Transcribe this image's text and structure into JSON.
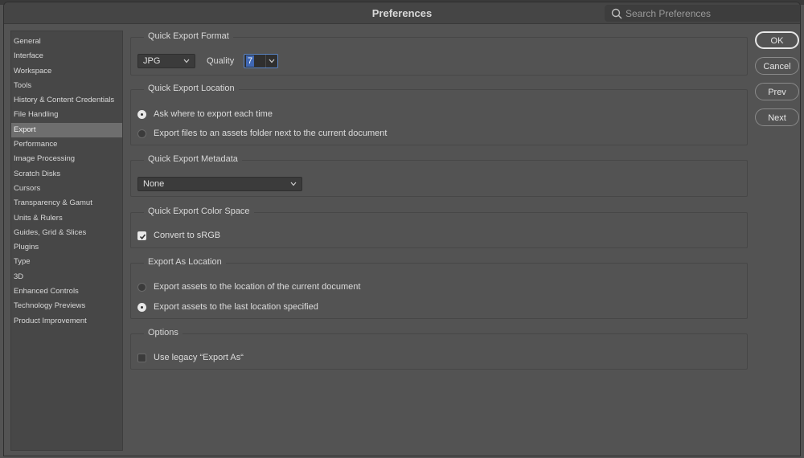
{
  "window": {
    "title": "Preferences"
  },
  "search": {
    "placeholder": "Search Preferences"
  },
  "sidebar": {
    "items": [
      {
        "label": "General"
      },
      {
        "label": "Interface"
      },
      {
        "label": "Workspace"
      },
      {
        "label": "Tools"
      },
      {
        "label": "History & Content Credentials"
      },
      {
        "label": "File Handling"
      },
      {
        "label": "Export"
      },
      {
        "label": "Performance"
      },
      {
        "label": "Image Processing"
      },
      {
        "label": "Scratch Disks"
      },
      {
        "label": "Cursors"
      },
      {
        "label": "Transparency & Gamut"
      },
      {
        "label": "Units & Rulers"
      },
      {
        "label": "Guides, Grid & Slices"
      },
      {
        "label": "Plugins"
      },
      {
        "label": "Type"
      },
      {
        "label": "3D"
      },
      {
        "label": "Enhanced Controls"
      },
      {
        "label": "Technology Previews"
      },
      {
        "label": "Product Improvement"
      }
    ],
    "active": "Export"
  },
  "sections": {
    "format": {
      "title": "Quick Export Format",
      "format_value": "JPG",
      "quality_label": "Quality",
      "quality_value": "7"
    },
    "location": {
      "title": "Quick Export Location",
      "options": [
        {
          "label": "Ask where to export each time",
          "selected": true
        },
        {
          "label": "Export files to an assets folder next to the current document",
          "selected": false
        }
      ]
    },
    "metadata": {
      "title": "Quick Export Metadata",
      "value": "None"
    },
    "colorspace": {
      "title": "Quick Export Color Space",
      "checkbox_label": "Convert to sRGB",
      "checked": true
    },
    "export_as": {
      "title": "Export As Location",
      "options": [
        {
          "label": "Export assets to the location of the current document",
          "selected": false
        },
        {
          "label": "Export assets to the last location specified",
          "selected": true
        }
      ]
    },
    "options": {
      "title": "Options",
      "checkbox_label": "Use legacy “Export As“",
      "checked": false
    }
  },
  "buttons": {
    "ok": "OK",
    "cancel": "Cancel",
    "prev": "Prev",
    "next": "Next"
  },
  "colors": {
    "dialog_bg": "#535353",
    "sidebar_bg": "#474747",
    "selection": "#6e6e6e",
    "focus_blue": "#3f67b3"
  }
}
